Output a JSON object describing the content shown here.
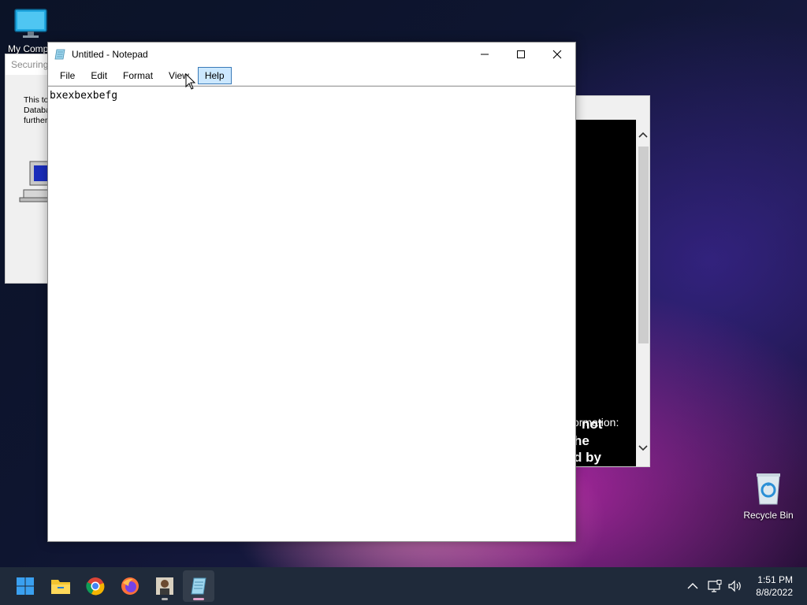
{
  "desktop": {
    "icons": [
      {
        "label": "My Compu",
        "icon": "monitor-icon"
      },
      {
        "label": "Recycle Bin",
        "icon": "recycle-bin-icon"
      }
    ]
  },
  "back_window_left": {
    "title": "Securing",
    "lines": [
      "This to",
      "Databa",
      "further"
    ]
  },
  "back_window_right": {
    "term_lines": [
      "ormation:",
      "not",
      "he",
      "d by"
    ]
  },
  "notepad": {
    "title": "Untitled - Notepad",
    "menu": [
      "File",
      "Edit",
      "Format",
      "View",
      "Help"
    ],
    "active_menu": "Help",
    "content": "bxexbexbefg"
  },
  "taskbar": {
    "apps": [
      "start-icon",
      "file-explorer-icon",
      "chrome-icon",
      "firefox-icon",
      "user-app-icon",
      "notepad-icon"
    ],
    "clock": {
      "time": "1:51 PM",
      "date": "8/8/2022"
    }
  }
}
